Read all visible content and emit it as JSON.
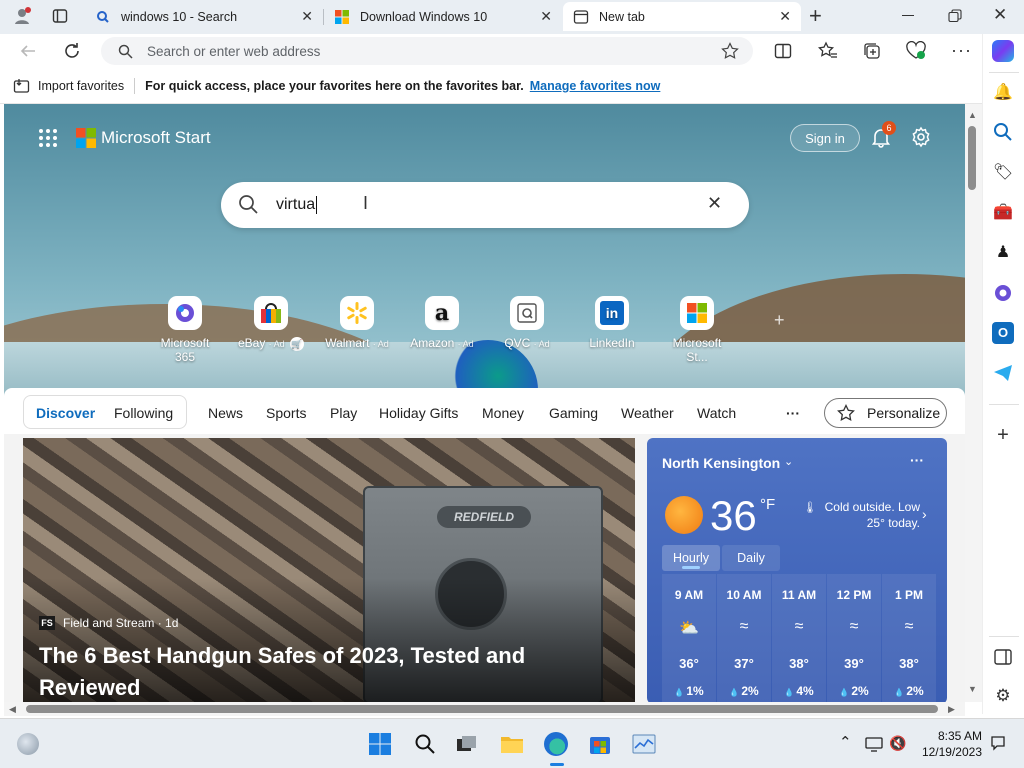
{
  "tabs": [
    {
      "label": "windows 10 - Search"
    },
    {
      "label": "Download Windows 10"
    },
    {
      "label": "New tab"
    }
  ],
  "address": {
    "placeholder": "Search or enter web address"
  },
  "favorites_bar": {
    "import_label": "Import favorites",
    "message": "For quick access, place your favorites here on the favorites bar.",
    "manage_link": "Manage favorites now"
  },
  "page": {
    "brand": "Microsoft Start",
    "sign_in": "Sign in",
    "notification_count": "6",
    "search_value": "virtua",
    "quick_links": [
      {
        "label": "Microsoft 365",
        "ad": ""
      },
      {
        "label": "eBay",
        "ad": "· Ad"
      },
      {
        "label": "Walmart",
        "ad": "· Ad"
      },
      {
        "label": "Amazon",
        "ad": "· Ad"
      },
      {
        "label": "QVC",
        "ad": "· Ad"
      },
      {
        "label": "LinkedIn",
        "ad": ""
      },
      {
        "label": "Microsoft St...",
        "ad": ""
      }
    ],
    "nav": {
      "discover": "Discover",
      "following": "Following",
      "items": [
        "News",
        "Sports",
        "Play",
        "Holiday Gifts",
        "Money",
        "Gaming",
        "Weather",
        "Watch"
      ],
      "more": "···",
      "personalize": "Personalize"
    },
    "card": {
      "source_logo": "FS",
      "source": "Field and Stream · 1d",
      "title": "The 6 Best Handgun Safes of 2023, Tested and Reviewed",
      "safe_brand": "REDFIELD"
    },
    "weather": {
      "location": "North Kensington",
      "temp": "36",
      "unit": "°F",
      "summary": "Cold outside. Low 25° today.",
      "tab_hourly": "Hourly",
      "tab_daily": "Daily",
      "hours": [
        {
          "time": "9 AM",
          "temp": "36°",
          "precip": "1%"
        },
        {
          "time": "10 AM",
          "temp": "37°",
          "precip": "2%"
        },
        {
          "time": "11 AM",
          "temp": "38°",
          "precip": "4%"
        },
        {
          "time": "12 PM",
          "temp": "39°",
          "precip": "2%"
        },
        {
          "time": "1 PM",
          "temp": "38°",
          "precip": "2%"
        }
      ]
    }
  },
  "taskbar": {
    "time": "8:35 AM",
    "date": "12/19/2023"
  },
  "colors": {
    "accent": "#0f6cbd",
    "tab_strip": "#e9eef3",
    "taskbar": "#e8edf2",
    "weather_card": "#4a6cc0"
  }
}
